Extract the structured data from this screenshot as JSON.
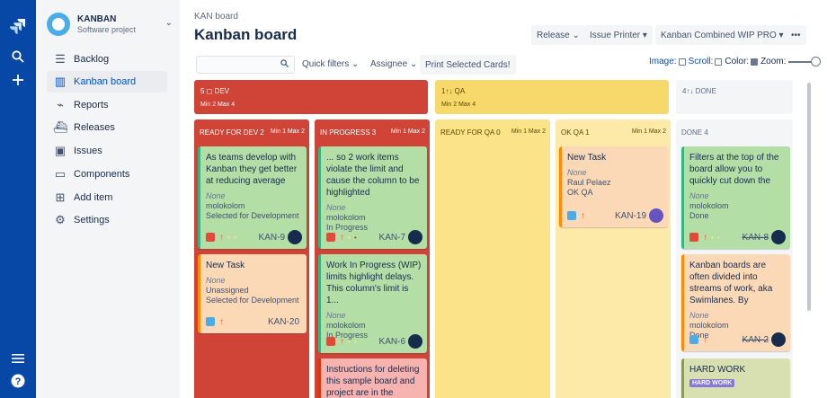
{
  "nav_icons": {
    "logo": "jira-logo-icon",
    "search": "search-icon",
    "create": "plus-icon",
    "menu": "hamburger-menu-icon",
    "help": "help-icon"
  },
  "project": {
    "name": "KANBAN",
    "type": "Software project"
  },
  "sidebar": {
    "items": [
      {
        "label": "Backlog",
        "icon": "backlog-icon"
      },
      {
        "label": "Kanban board",
        "icon": "board-icon",
        "active": true
      },
      {
        "label": "Reports",
        "icon": "reports-icon"
      },
      {
        "label": "Releases",
        "icon": "releases-icon"
      },
      {
        "label": "Issues",
        "icon": "issues-icon"
      },
      {
        "label": "Components",
        "icon": "components-icon"
      },
      {
        "label": "Add item",
        "icon": "add-item-icon"
      },
      {
        "label": "Settings",
        "icon": "settings-icon"
      }
    ]
  },
  "header": {
    "breadcrumb": "KAN board",
    "title": "Kanban board",
    "release": "Release",
    "issue_printer": "Issue Printer",
    "wip": "Kanban Combined WIP PRO",
    "more": "•••"
  },
  "filters": {
    "search_placeholder": "",
    "quick_filters": "Quick filters",
    "assignee": "Assignee",
    "print": "Print Selected Cards!",
    "image": "Image:",
    "scroll": "Scroll:",
    "color": "Color:",
    "zoom": "Zoom:"
  },
  "colors": {
    "dev": "#d04437",
    "qa": "#f6d86b",
    "done_lane": "#f4f5f7",
    "col_dev": "#d04437",
    "col_qa": "#fbe38a",
    "col_okqa": "#fde9a8",
    "col_done": "#f4f5f7"
  },
  "lanes": {
    "dev": {
      "name": "5 ◻ DEV",
      "limits": "Min 2 Max 4"
    },
    "qa": {
      "name": "1↑↓ QA",
      "limits": "Min 2 Max 4"
    },
    "done": {
      "name": "4↑↓ DONE"
    }
  },
  "columns": {
    "ready_dev": {
      "name": "READY FOR DEV 2",
      "limits": "Min 1  Max 2"
    },
    "in_progress": {
      "name": "IN PROGRESS 3",
      "limits": "Min 1  Max 2"
    },
    "ready_qa": {
      "name": "READY FOR QA 0",
      "limits": "Min 1  Max 2"
    },
    "ok_qa": {
      "name": "OK QA 1",
      "limits": "Min 1  Max 2"
    },
    "done": {
      "name": "DONE 4"
    }
  },
  "cards": {
    "kan9": {
      "summary": "As teams develop with Kanban they get better at reducing average",
      "fix": "None",
      "assignee": "molokolom",
      "status": "Selected for Development",
      "key": "KAN-9",
      "type": "bug-icon"
    },
    "kan20": {
      "summary": "New Task",
      "fix": "None",
      "assignee": "Unassigned",
      "status": "Selected for Development",
      "key": "KAN-20",
      "type": "task-icon"
    },
    "kan7": {
      "summary": "... so 2 work items violate the limit and cause the column to be highlighted",
      "fix": "None",
      "assignee": "molokolom",
      "status": "In Progress",
      "key": "KAN-7",
      "type": "bug-icon"
    },
    "kan6": {
      "summary": "Work In Progress (WIP) limits highlight delays. This column's limit is 1...",
      "fix": "None",
      "assignee": "molokolom",
      "status": "In Progress",
      "key": "KAN-6",
      "type": "bug-icon"
    },
    "kan_del": {
      "summary": "Instructions for deleting this sample board and project are in the"
    },
    "kan19": {
      "summary": "New Task",
      "fix": "None",
      "assignee": "Raul Pelaez",
      "status": "OK QA",
      "key": "KAN-19",
      "type": "task-icon"
    },
    "kan8": {
      "summary": "Filters at the top of the board allow you to quickly cut down the",
      "fix": "None",
      "assignee": "molokolom",
      "status": "Done",
      "key": "KAN-8",
      "type": "bug-icon"
    },
    "kan2": {
      "summary": "Kanban boards are often divided into streams of work, aka Swimlanes. By",
      "fix": "None",
      "assignee": "molokolom",
      "status": "Done",
      "key": "KAN-2",
      "type": "task-icon"
    },
    "hard": {
      "summary": "HARD WORK",
      "label": "HARD WORK"
    }
  }
}
